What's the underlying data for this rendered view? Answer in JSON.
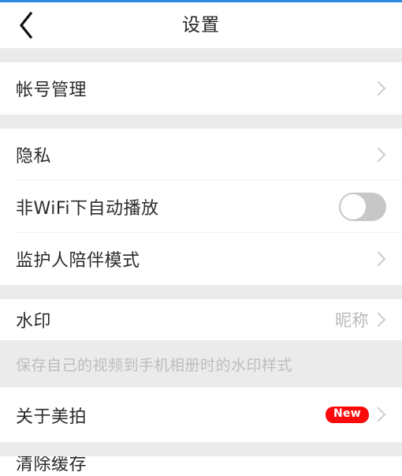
{
  "theme": {
    "progress_color": "#2e8be0",
    "section_bg": "#ebebeb",
    "row_bg": "#ffffff",
    "label_color": "#2b2b2b",
    "value_color": "#b9b9b9",
    "badge_color": "#fa0a0a",
    "toggle_off_color": "#c7c7c7"
  },
  "header": {
    "back_icon": "chevron-left-icon",
    "title": "设置"
  },
  "sections": [
    {
      "rows": [
        {
          "label": "帐号管理",
          "accessory": "chevron-right-icon"
        }
      ]
    },
    {
      "rows": [
        {
          "label": "隐私",
          "accessory": "chevron-right-icon"
        },
        {
          "label": "非WiFi下自动播放",
          "accessory": "toggle",
          "toggle_on": false
        },
        {
          "label": "监护人陪伴模式",
          "accessory": "chevron-right-icon"
        }
      ]
    },
    {
      "rows": [
        {
          "label": "水印",
          "value": "昵称",
          "accessory": "chevron-right-icon"
        }
      ],
      "description": "保存自己的视频到手机相册时的水印样式",
      "rows_after": [
        {
          "label": "关于美拍",
          "badge": "New",
          "accessory": "chevron-right-icon"
        }
      ]
    }
  ],
  "bottom_partial_row": {
    "label": "清除缓存"
  }
}
